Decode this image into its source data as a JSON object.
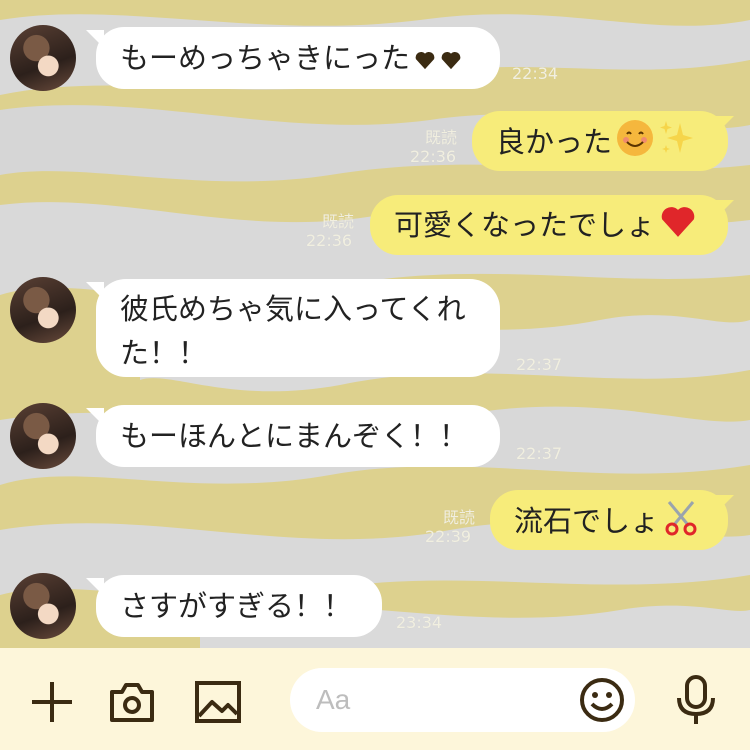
{
  "messages": [
    {
      "id": "m1",
      "direction": "in",
      "text": "もーめっちゃきにった",
      "emoji": [
        "heart-black",
        "heart-black"
      ],
      "time": "22:34"
    },
    {
      "id": "m2",
      "direction": "out",
      "text": "良かった",
      "emoji": [
        "smiling-face",
        "sparkles"
      ],
      "read": "既読",
      "time": "22:36"
    },
    {
      "id": "m3",
      "direction": "out",
      "text": "可愛くなったでしょ",
      "emoji": [
        "red-heart"
      ],
      "read": "既読",
      "time": "22:36"
    },
    {
      "id": "m4",
      "direction": "in",
      "text": "彼氏めちゃ気に入ってくれた！！",
      "time": "22:37"
    },
    {
      "id": "m5",
      "direction": "in",
      "text": "もーほんとにまんぞく！！",
      "time": "22:37"
    },
    {
      "id": "m6",
      "direction": "out",
      "text": "流石でしょ",
      "emoji": [
        "scissors"
      ],
      "read": "既読",
      "time": "22:39"
    },
    {
      "id": "m7",
      "direction": "in",
      "text": "さすがすぎる！！",
      "time": "23:34"
    }
  ],
  "input": {
    "placeholder": "Aa"
  },
  "toolbar": {
    "icons": [
      "plus-icon",
      "camera-icon",
      "image-icon",
      "emoji-icon",
      "microphone-icon"
    ]
  },
  "colors": {
    "background": "#ddd18e",
    "incoming_bubble": "#ffffff",
    "outgoing_bubble": "#f7ec7a",
    "bar": "#fdf6da",
    "icons": "#3b2b12"
  }
}
